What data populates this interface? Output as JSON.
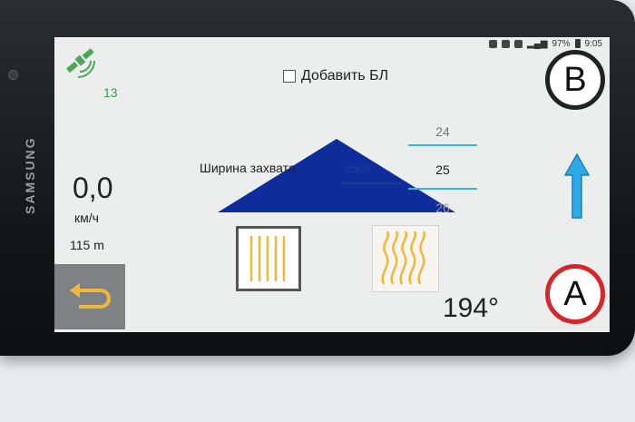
{
  "device": {
    "brand": "SAMSUNG"
  },
  "status_bar": {
    "battery": "97%",
    "time": "9:05"
  },
  "gps": {
    "icon": "satellite-icon",
    "satellite_count": "13"
  },
  "checkbox": {
    "label": "Добавить БЛ",
    "checked": false
  },
  "buttons": {
    "b_label": "B",
    "a_label": "A"
  },
  "speed": {
    "value": "0,0",
    "unit": "км/ч"
  },
  "distance": "115 m",
  "width": {
    "label": "Ширина захвата",
    "value": "25,0"
  },
  "picker": {
    "above": "24",
    "selected": "25",
    "below": "26"
  },
  "heading": "194°",
  "colors": {
    "triangle": "#0f2d9a",
    "arrow": "#30a9e6",
    "pattern": "#f2b63a",
    "a_ring": "#d8252c"
  }
}
